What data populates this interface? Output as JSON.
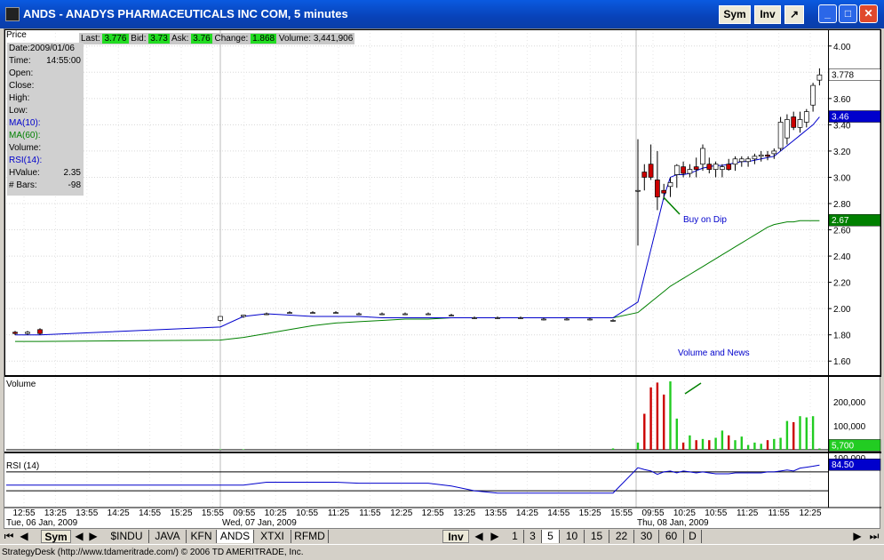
{
  "window": {
    "title": "ANDS - ANADYS PHARMACEUTICALS INC COM, 5 minutes",
    "sym_btn": "Sym",
    "inv_btn": "Inv"
  },
  "quote": {
    "last_label": "Last:",
    "last": "3.776",
    "bid_label": "Bid:",
    "bid": "3.73",
    "ask_label": "Ask:",
    "ask": "3.76",
    "change_label": "Change:",
    "change": "1.868",
    "volume_label": "Volume:",
    "volume": "3,441,906"
  },
  "panels": {
    "price": "Price",
    "volume": "Volume",
    "rsi": "RSI (14)"
  },
  "info": {
    "date": "Date:2009/01/06",
    "time_label": "Time:",
    "time": "14:55:00",
    "open": "Open:",
    "close": "Close:",
    "high": "High:",
    "low": "Low:",
    "ma10": "MA(10):",
    "ma60": "MA(60):",
    "volume": "Volume:",
    "rsi": "RSI(14):",
    "hvalue_label": "HValue:",
    "hvalue": "2.35",
    "bars_label": "# Bars:",
    "bars": "-98"
  },
  "annotations": {
    "buy": "Buy on Dip",
    "news": "Volume and News"
  },
  "price_axis": [
    "4.00",
    "3.80",
    "3.60",
    "3.40",
    "3.20",
    "3.00",
    "2.80",
    "2.60",
    "2.40",
    "2.20",
    "2.00",
    "1.80",
    "1.60"
  ],
  "volume_axis": [
    "200,000",
    "100,000"
  ],
  "rsi_axis_top": "100.000",
  "markers": {
    "last": "3.778",
    "ma10": "3.46",
    "ma60": "2.67",
    "volume": "5,700",
    "rsi": "84.50"
  },
  "time_labels": [
    "12:55",
    "13:25",
    "13:55",
    "14:25",
    "14:55",
    "15:25",
    "15:55",
    "09:55",
    "10:25",
    "10:55",
    "11:25",
    "11:55",
    "12:25",
    "12:55",
    "13:25",
    "13:55",
    "14:25",
    "14:55",
    "15:25",
    "15:55",
    "09:55",
    "10:25",
    "10:55",
    "11:25",
    "11:55",
    "12:25"
  ],
  "date_labels": [
    "Tue, 06 Jan, 2009",
    "Wed, 07 Jan, 2009",
    "Thu, 08 Jan, 2009"
  ],
  "colors": {
    "up": "#ffffff",
    "down": "#cc0000",
    "ma10": "#0000cc",
    "ma60": "#008000",
    "vol_up": "#22cc22",
    "vol_down": "#cc0000"
  },
  "bottom_bar": {
    "sym": "Sym",
    "tabs": [
      "$INDU",
      "JAVA",
      "KFN",
      "ANDS",
      "XTXI",
      "RFMD"
    ],
    "inv": "Inv",
    "intervals": [
      "1",
      "3",
      "5",
      "10",
      "15",
      "22",
      "30",
      "60",
      "D"
    ]
  },
  "status": "StrategyDesk (http://www.tdameritrade.com/) © 2006 TD AMERITRADE, Inc.",
  "chart_data": {
    "type": "candlestick",
    "title": "ANDS - ANADYS PHARMACEUTICALS INC COM, 5 minutes",
    "ylim": [
      1.5,
      4.1
    ],
    "candles": [
      {
        "i": 0,
        "o": 1.82,
        "h": 1.83,
        "l": 1.8,
        "c": 1.81
      },
      {
        "i": 1,
        "o": 1.81,
        "h": 1.83,
        "l": 1.8,
        "c": 1.82
      },
      {
        "i": 2,
        "o": 1.84,
        "h": 1.85,
        "l": 1.8,
        "c": 1.81
      },
      {
        "i": 3,
        "o": 1.91,
        "h": 1.94,
        "l": 1.9,
        "c": 1.94
      },
      {
        "i": 4,
        "o": 1.94,
        "h": 1.95,
        "l": 1.93,
        "c": 1.95
      },
      {
        "i": 5,
        "o": 1.96,
        "h": 1.97,
        "l": 1.95,
        "c": 1.96
      },
      {
        "i": 6,
        "o": 1.97,
        "h": 1.98,
        "l": 1.96,
        "c": 1.97
      },
      {
        "i": 7,
        "o": 1.97,
        "h": 1.98,
        "l": 1.96,
        "c": 1.97
      },
      {
        "i": 8,
        "o": 1.97,
        "h": 1.98,
        "l": 1.96,
        "c": 1.97
      },
      {
        "i": 9,
        "o": 1.96,
        "h": 1.97,
        "l": 1.95,
        "c": 1.96
      },
      {
        "i": 10,
        "o": 1.96,
        "h": 1.97,
        "l": 1.95,
        "c": 1.96
      },
      {
        "i": 11,
        "o": 1.96,
        "h": 1.97,
        "l": 1.95,
        "c": 1.96
      },
      {
        "i": 12,
        "o": 1.96,
        "h": 1.97,
        "l": 1.95,
        "c": 1.96
      },
      {
        "i": 13,
        "o": 1.95,
        "h": 1.96,
        "l": 1.94,
        "c": 1.95
      },
      {
        "i": 14,
        "o": 1.93,
        "h": 1.94,
        "l": 1.92,
        "c": 1.93
      },
      {
        "i": 15,
        "o": 1.93,
        "h": 1.94,
        "l": 1.92,
        "c": 1.93
      },
      {
        "i": 16,
        "o": 1.93,
        "h": 1.94,
        "l": 1.92,
        "c": 1.93
      },
      {
        "i": 17,
        "o": 1.92,
        "h": 1.93,
        "l": 1.91,
        "c": 1.92
      },
      {
        "i": 18,
        "o": 1.92,
        "h": 1.93,
        "l": 1.91,
        "c": 1.92
      },
      {
        "i": 19,
        "o": 1.92,
        "h": 1.93,
        "l": 1.91,
        "c": 1.92
      },
      {
        "i": 20,
        "o": 1.91,
        "h": 1.92,
        "l": 1.9,
        "c": 1.91
      },
      {
        "i": 21,
        "o": 2.9,
        "h": 3.29,
        "l": 2.48,
        "c": 2.9
      },
      {
        "i": 22,
        "o": 3.04,
        "h": 3.1,
        "l": 2.9,
        "c": 3.0
      },
      {
        "i": 23,
        "o": 3.1,
        "h": 3.25,
        "l": 2.98,
        "c": 3.0
      },
      {
        "i": 24,
        "o": 2.98,
        "h": 3.2,
        "l": 2.75,
        "c": 2.85
      },
      {
        "i": 25,
        "o": 2.9,
        "h": 2.95,
        "l": 2.83,
        "c": 2.88
      },
      {
        "i": 26,
        "o": 2.93,
        "h": 3.0,
        "l": 2.85,
        "c": 2.96
      },
      {
        "i": 27,
        "o": 3.02,
        "h": 3.1,
        "l": 2.92,
        "c": 3.09
      },
      {
        "i": 28,
        "o": 3.08,
        "h": 3.12,
        "l": 3.0,
        "c": 3.03
      },
      {
        "i": 29,
        "o": 3.03,
        "h": 3.1,
        "l": 3.0,
        "c": 3.06
      },
      {
        "i": 30,
        "o": 3.08,
        "h": 3.15,
        "l": 3.0,
        "c": 3.06
      },
      {
        "i": 31,
        "o": 3.1,
        "h": 3.25,
        "l": 3.05,
        "c": 3.22
      },
      {
        "i": 32,
        "o": 3.1,
        "h": 3.15,
        "l": 3.03,
        "c": 3.06
      },
      {
        "i": 33,
        "o": 3.06,
        "h": 3.12,
        "l": 3.0,
        "c": 3.1
      },
      {
        "i": 34,
        "o": 3.06,
        "h": 3.1,
        "l": 3.0,
        "c": 3.08
      },
      {
        "i": 35,
        "o": 3.1,
        "h": 3.14,
        "l": 3.05,
        "c": 3.06
      },
      {
        "i": 36,
        "o": 3.1,
        "h": 3.16,
        "l": 3.05,
        "c": 3.14
      },
      {
        "i": 37,
        "o": 3.12,
        "h": 3.16,
        "l": 3.08,
        "c": 3.14
      },
      {
        "i": 38,
        "o": 3.12,
        "h": 3.16,
        "l": 3.08,
        "c": 3.14
      },
      {
        "i": 39,
        "o": 3.14,
        "h": 3.18,
        "l": 3.1,
        "c": 3.16
      },
      {
        "i": 40,
        "o": 3.16,
        "h": 3.2,
        "l": 3.12,
        "c": 3.17
      },
      {
        "i": 41,
        "o": 3.17,
        "h": 3.2,
        "l": 3.13,
        "c": 3.16
      },
      {
        "i": 42,
        "o": 3.18,
        "h": 3.22,
        "l": 3.14,
        "c": 3.2
      },
      {
        "i": 43,
        "o": 3.22,
        "h": 3.46,
        "l": 3.2,
        "c": 3.42
      },
      {
        "i": 44,
        "o": 3.3,
        "h": 3.48,
        "l": 3.25,
        "c": 3.44
      },
      {
        "i": 45,
        "o": 3.46,
        "h": 3.5,
        "l": 3.36,
        "c": 3.38
      },
      {
        "i": 46,
        "o": 3.38,
        "h": 3.5,
        "l": 3.34,
        "c": 3.44
      },
      {
        "i": 47,
        "o": 3.42,
        "h": 3.52,
        "l": 3.38,
        "c": 3.5
      },
      {
        "i": 48,
        "o": 3.55,
        "h": 3.72,
        "l": 3.5,
        "c": 3.7
      },
      {
        "i": 49,
        "o": 3.74,
        "h": 3.83,
        "l": 3.7,
        "c": 3.78
      }
    ],
    "volume": [
      0,
      0,
      0,
      2000,
      2000,
      0,
      0,
      0,
      0,
      0,
      0,
      0,
      0,
      0,
      0,
      0,
      0,
      0,
      0,
      0,
      5700,
      30000,
      150000,
      260000,
      280000,
      230000,
      285000,
      130000,
      30000,
      60000,
      40000,
      45000,
      40000,
      50000,
      80000,
      60000,
      40000,
      55000,
      20000,
      30000,
      25000,
      40000,
      45000,
      50000,
      120000,
      115000,
      140000,
      135000,
      140000,
      5700
    ],
    "ma10": [
      1.8,
      1.8,
      1.8,
      1.86,
      1.94,
      1.96,
      1.95,
      1.94,
      1.94,
      1.94,
      1.93,
      1.93,
      1.93,
      1.93,
      1.93,
      1.93,
      1.93,
      1.93,
      1.93,
      1.93,
      1.93,
      2.05,
      2.25,
      2.45,
      2.65,
      2.85,
      3.0,
      3.02,
      3.02,
      3.03,
      3.05,
      3.07,
      3.08,
      3.09,
      3.09,
      3.1,
      3.11,
      3.12,
      3.12,
      3.13,
      3.14,
      3.15,
      3.16,
      3.2,
      3.24,
      3.28,
      3.32,
      3.36,
      3.4,
      3.46
    ],
    "ma60": [
      1.75,
      1.75,
      1.75,
      1.76,
      1.78,
      1.81,
      1.84,
      1.87,
      1.89,
      1.9,
      1.91,
      1.92,
      1.92,
      1.93,
      1.93,
      1.93,
      1.93,
      1.93,
      1.93,
      1.93,
      1.93,
      1.97,
      2.01,
      2.05,
      2.09,
      2.13,
      2.17,
      2.2,
      2.23,
      2.26,
      2.29,
      2.32,
      2.35,
      2.38,
      2.41,
      2.44,
      2.47,
      2.5,
      2.53,
      2.56,
      2.59,
      2.62,
      2.64,
      2.65,
      2.66,
      2.66,
      2.67,
      2.67,
      2.67,
      2.67
    ],
    "rsi": [
      42,
      42,
      42,
      42,
      42,
      48,
      48,
      48,
      48,
      46,
      46,
      46,
      46,
      40,
      30,
      25,
      25,
      25,
      25,
      25,
      25,
      79,
      75,
      72,
      65,
      70,
      72,
      68,
      72,
      70,
      68,
      70,
      68,
      66,
      66,
      66,
      68,
      68,
      68,
      68,
      68,
      70,
      70,
      72,
      74,
      72,
      78,
      80,
      82,
      84.5
    ]
  }
}
